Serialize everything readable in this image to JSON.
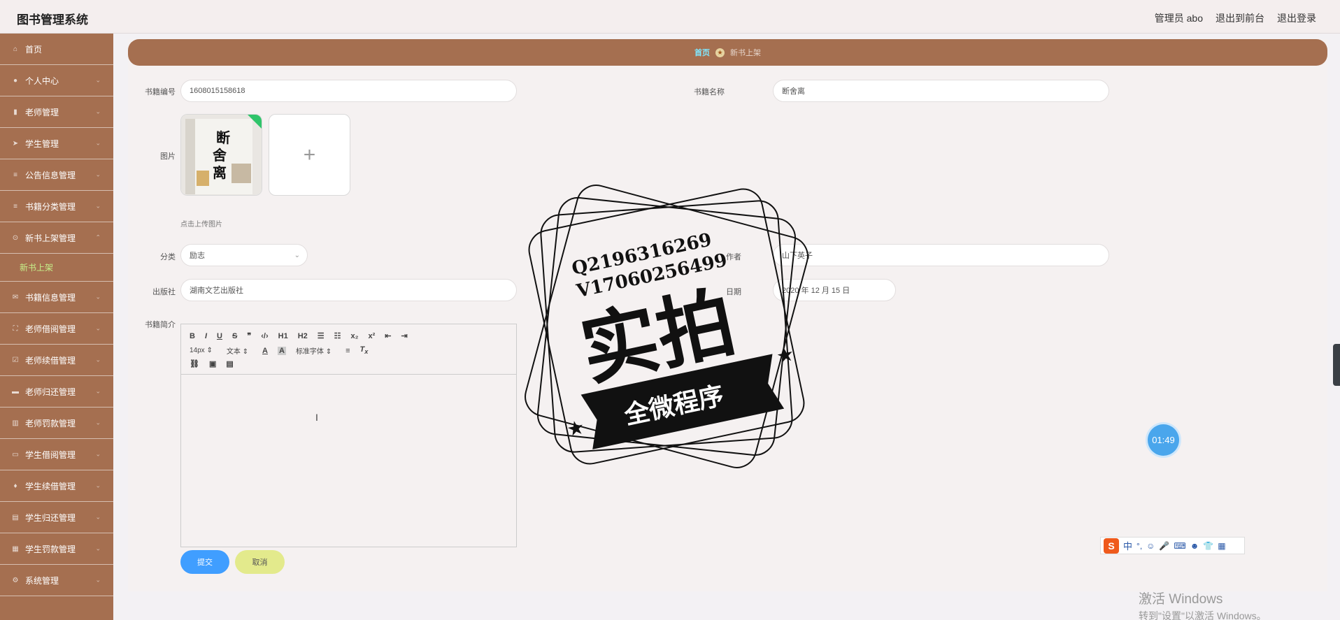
{
  "header": {
    "app_title": "图书管理系统",
    "user_label": "管理员 abo",
    "front_link": "退出到前台",
    "logout_link": "退出登录"
  },
  "sidebar": {
    "items": [
      {
        "label": "首页",
        "icon": "home-icon"
      },
      {
        "label": "个人中心",
        "icon": "user-icon"
      },
      {
        "label": "老师管理",
        "icon": "teacher-icon"
      },
      {
        "label": "学生管理",
        "icon": "plane-icon"
      },
      {
        "label": "公告信息管理",
        "icon": "list-icon"
      },
      {
        "label": "书籍分类管理",
        "icon": "list-icon"
      },
      {
        "label": "新书上架管理",
        "icon": "pin-icon",
        "expanded": true,
        "sub": "新书上架"
      },
      {
        "label": "书籍信息管理",
        "icon": "mail-icon"
      },
      {
        "label": "老师借阅管理",
        "icon": "expand-icon"
      },
      {
        "label": "老师续借管理",
        "icon": "check-icon"
      },
      {
        "label": "老师归还管理",
        "icon": "card-icon"
      },
      {
        "label": "老师罚款管理",
        "icon": "chart-icon"
      },
      {
        "label": "学生借阅管理",
        "icon": "screen-icon"
      },
      {
        "label": "学生续借管理",
        "icon": "bulb-icon"
      },
      {
        "label": "学生归还管理",
        "icon": "doc-icon"
      },
      {
        "label": "学生罚款管理",
        "icon": "grid-icon"
      },
      {
        "label": "系统管理",
        "icon": "gear-icon"
      }
    ]
  },
  "breadcrumb": {
    "home": "首页",
    "current": "新书上架"
  },
  "form": {
    "book_no_label": "书籍编号",
    "book_no_value": "1608015158618",
    "book_name_label": "书籍名称",
    "book_name_value": "断舍离",
    "image_label": "图片",
    "upload_hint": "点击上传图片",
    "category_label": "分类",
    "category_value": "励志",
    "author_label": "作者",
    "author_value": "山下英子",
    "publisher_label": "出版社",
    "publisher_value": "湖南文艺出版社",
    "date_label": "日期",
    "date_value": "2020 年 12 月 15 日",
    "intro_label": "书籍简介",
    "toolbar": {
      "row1": [
        "B",
        "I",
        "U",
        "S",
        "❞",
        "‹/›",
        "H1",
        "H2",
        "☰",
        "☷",
        "x₂",
        "x²",
        "⇤",
        "⇥"
      ],
      "font_size": "14px",
      "text_style": "文本",
      "font_family": "标准字体"
    },
    "submit_label": "提交",
    "cancel_label": "取消"
  },
  "book_cover": {
    "title_chars": [
      "断",
      "舍",
      "离"
    ]
  },
  "stamp": {
    "line1": "Q2196316269",
    "line2": "V17060256499",
    "main": "实拍",
    "banner": "全微程序"
  },
  "overlay": {
    "timer": "01:49",
    "ime_char": "中",
    "activate_title": "激活 Windows",
    "activate_sub": "转到\"设置\"以激活 Windows。"
  }
}
